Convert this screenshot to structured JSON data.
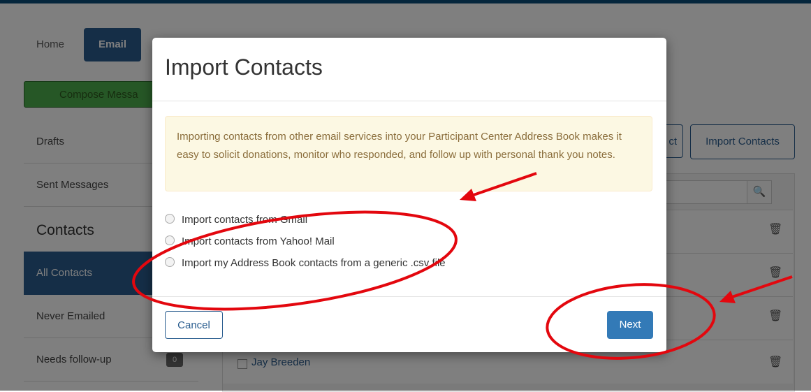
{
  "nav": {
    "home": "Home",
    "email": "Email",
    "compose": "Compose Messa",
    "drafts": "Drafts",
    "sent": "Sent Messages",
    "contacts_heading": "Contacts",
    "all_contacts": "All Contacts",
    "never_emailed": "Never Emailed",
    "needs_followup": "Needs follow-up",
    "needs_followup_count": "0"
  },
  "toolbar": {
    "select_fragment": "ct",
    "import_contacts": "Import Contacts",
    "search_icon": "search-icon"
  },
  "table": {
    "visible_name": "Jay Breeden",
    "trash_icon": "trash-icon"
  },
  "modal": {
    "title": "Import Contacts",
    "alert": "Importing contacts from other email services into your Participant Center Address Book makes it easy to solicit donations, monitor who responded, and follow up with personal thank you notes.",
    "options": [
      "Import contacts from Gmail",
      "Import contacts from Yahoo! Mail",
      "Import my Address Book contacts from a generic .csv file"
    ],
    "cancel": "Cancel",
    "next": "Next"
  },
  "colors": {
    "primary": "#337ab7",
    "dark_blue": "#2a5d8f",
    "annotation_red": "#e3070e",
    "alert_bg": "#fcf8e3",
    "alert_text": "#8a6d3b"
  }
}
